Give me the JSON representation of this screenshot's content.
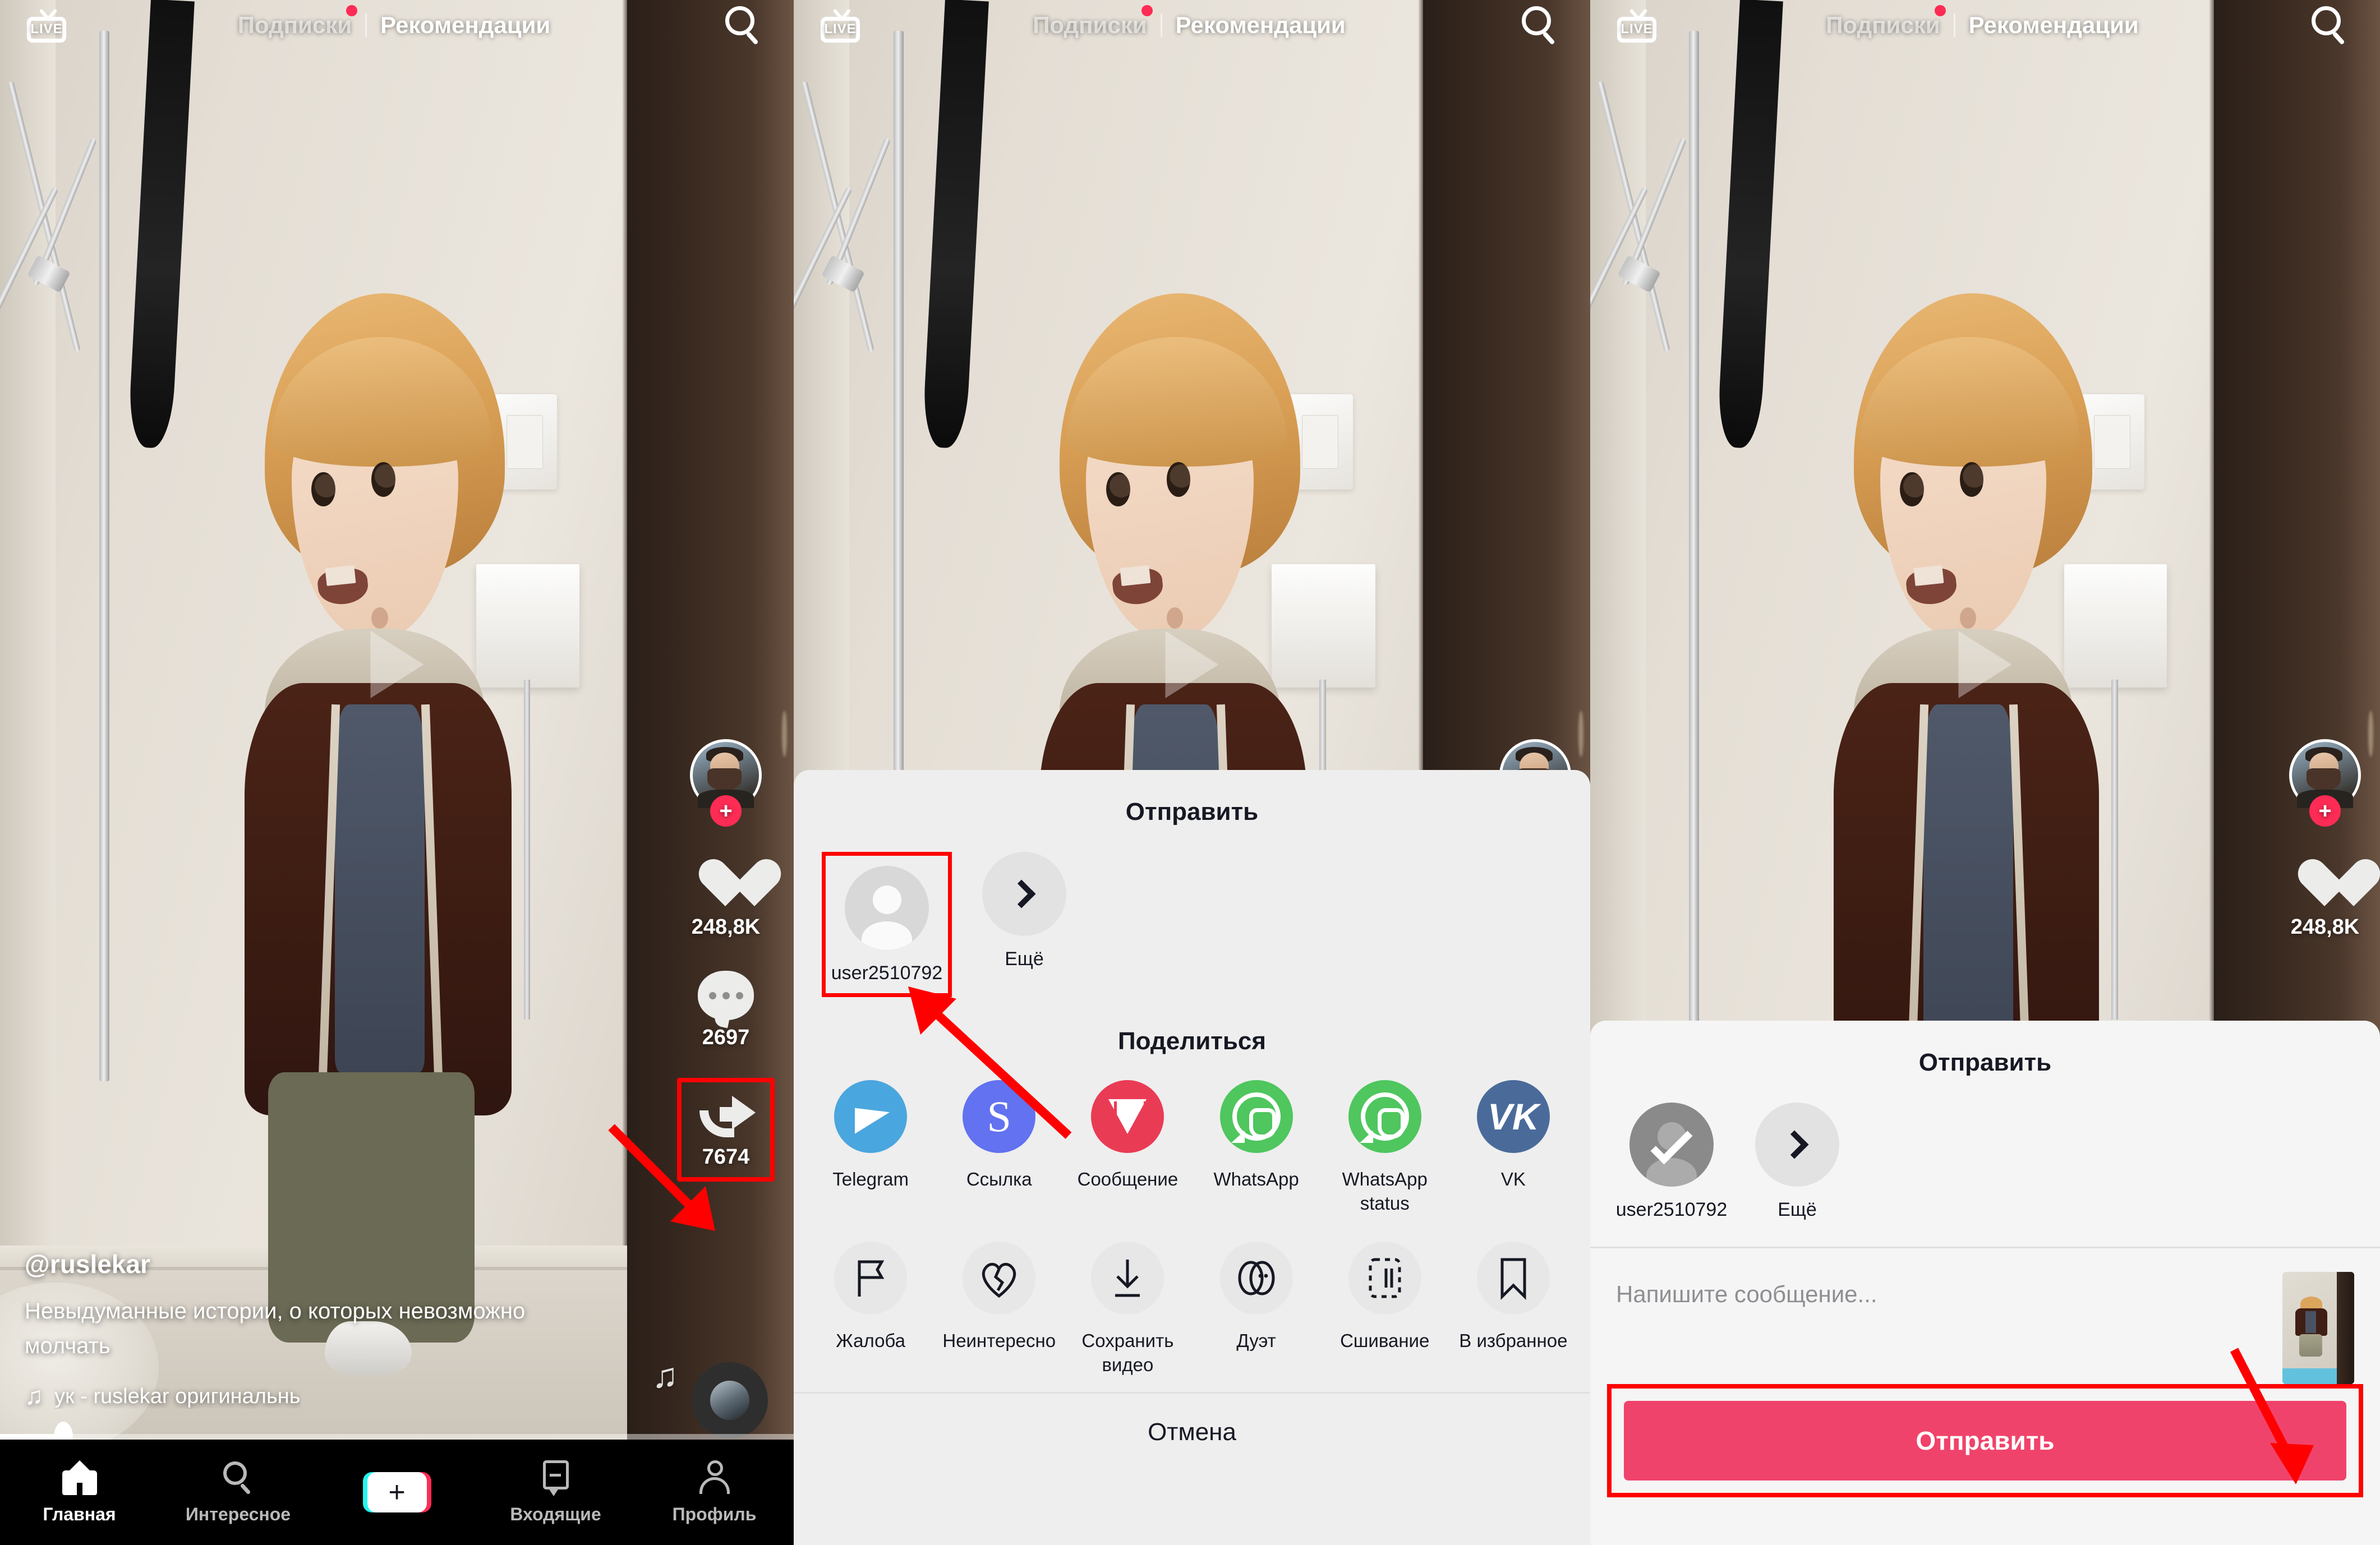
{
  "app": {
    "top_nav": {
      "live_label": "LIVE",
      "tabs": [
        {
          "label": "Подписки",
          "active": false,
          "badge_dot": true
        },
        {
          "label": "Рекомендации",
          "active": true,
          "badge_dot": false
        }
      ],
      "search_icon": "search-icon"
    },
    "action_rail": {
      "follow_badge": "+",
      "like_count": "248,8K",
      "comment_count": "2697",
      "share_count": "7674"
    },
    "caption": {
      "username": "@ruslekar",
      "text": "Невыдуманные истории, о которых невозможно молчать",
      "music": "ук - ruslekar   оригинальнь"
    },
    "tab_bar": [
      {
        "label": "Главная",
        "icon": "home-icon",
        "active": true
      },
      {
        "label": "Интересное",
        "icon": "search-icon",
        "active": false
      },
      {
        "label": "",
        "icon": "create-plus-icon",
        "active": false
      },
      {
        "label": "Входящие",
        "icon": "inbox-icon",
        "active": false
      },
      {
        "label": "Профиль",
        "icon": "profile-icon",
        "active": false
      }
    ]
  },
  "share_sheet": {
    "title": "Отправить",
    "recipients": [
      {
        "name": "user2510792",
        "icon": "avatar-placeholder-icon",
        "selected": false
      },
      {
        "name": "Ещё",
        "icon": "chevron-right-icon",
        "selected": false
      }
    ],
    "share_section_title": "Поделиться",
    "share_targets": [
      {
        "label": "Telegram",
        "icon": "telegram-icon",
        "color": "#4aa6de"
      },
      {
        "label": "Ссылка",
        "icon": "link-icon",
        "color": "#6272f0"
      },
      {
        "label": "Сообщение",
        "icon": "message-icon",
        "color": "#ea3b55"
      },
      {
        "label": "WhatsApp",
        "icon": "whatsapp-icon",
        "color": "#4fc65e"
      },
      {
        "label": "WhatsApp status",
        "icon": "whatsapp-status-icon",
        "color": "#4fc65e"
      },
      {
        "label": "VK",
        "icon": "vk-icon",
        "color": "#4a6b9a"
      }
    ],
    "actions": [
      {
        "label": "Жалоба",
        "icon": "flag-icon"
      },
      {
        "label": "Неинтересно",
        "icon": "broken-heart-icon"
      },
      {
        "label": "Сохранить видео",
        "icon": "download-icon"
      },
      {
        "label": "Дуэт",
        "icon": "duet-icon"
      },
      {
        "label": "Сшивание",
        "icon": "stitch-icon"
      },
      {
        "label": "В избранное",
        "icon": "bookmark-icon"
      }
    ],
    "cancel_label": "Отмена"
  },
  "send_sheet": {
    "title": "Отправить",
    "recipients": [
      {
        "name": "user2510792",
        "icon": "avatar-selected-check-icon",
        "selected": true
      },
      {
        "name": "Ещё",
        "icon": "chevron-right-icon",
        "selected": false
      }
    ],
    "message_placeholder": "Напишите сообщение...",
    "send_button_label": "Отправить"
  },
  "annotation": {
    "color": "#ff0000",
    "highlight_boxes": [
      "share-button",
      "recipient-user2510792",
      "send-button"
    ]
  }
}
